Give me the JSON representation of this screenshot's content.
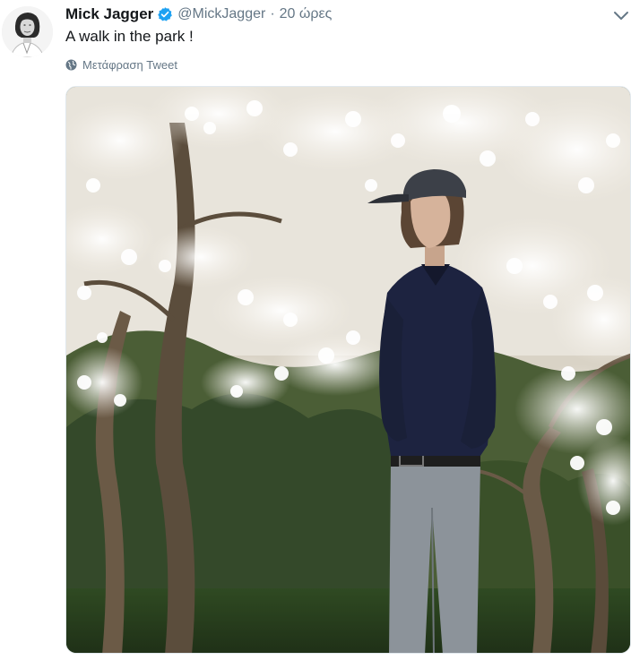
{
  "tweet": {
    "author": {
      "display_name": "Mick Jagger",
      "handle": "@MickJagger",
      "verified": true,
      "avatar_icon": "profile-photo"
    },
    "separator": "·",
    "timestamp": "20 ώρες",
    "text": "A walk in the park !",
    "translate_label": "Μετάφραση Tweet",
    "translate_icon": "globe-icon",
    "menu_icon": "chevron-down-icon",
    "media": {
      "type": "photo",
      "icon": "photo-man-under-blossoming-magnolia"
    }
  },
  "colors": {
    "text_primary": "#14171a",
    "text_secondary": "#657786",
    "verified_blue": "#1da1f2"
  }
}
